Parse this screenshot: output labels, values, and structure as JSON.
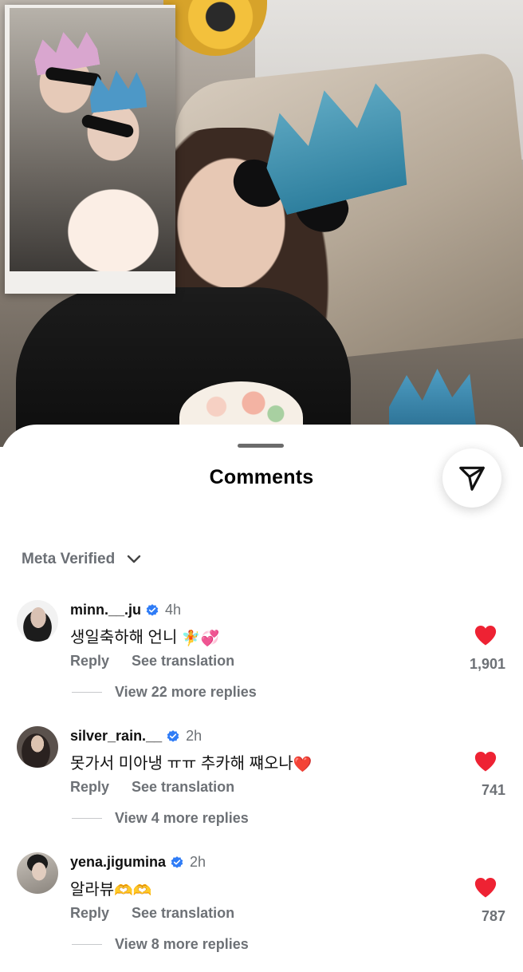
{
  "sheet": {
    "title": "Comments",
    "filter_label": "Meta Verified"
  },
  "icons": {
    "share": "paper-plane-icon",
    "dropdown": "chevron-down-icon",
    "verified": "verified-badge-icon",
    "like": "heart-filled-icon"
  },
  "colors": {
    "like_red": "#ee2233",
    "verified_blue": "#2f7cf6",
    "muted_text": "#6d7176"
  },
  "comments": [
    {
      "username": "minn.__.ju",
      "time": "4h",
      "text": "생일축하해 언니",
      "emojis": "🧚💞",
      "reply_label": "Reply",
      "translate_label": "See translation",
      "view_replies": "View 22 more replies",
      "likes": "1,901"
    },
    {
      "username": "silver_rain.__",
      "time": "2h",
      "text": "못가서 미아냉 ㅠㅠ 추카해 쨰오나",
      "emojis": "❤️",
      "reply_label": "Reply",
      "translate_label": "See translation",
      "view_replies": "View 4 more replies",
      "likes": "741"
    },
    {
      "username": "yena.jigumina",
      "time": "2h",
      "text": "알라뷰",
      "emojis": "🫶🫶",
      "reply_label": "Reply",
      "translate_label": "See translation",
      "view_replies": "View 8 more replies",
      "likes": "787"
    }
  ]
}
